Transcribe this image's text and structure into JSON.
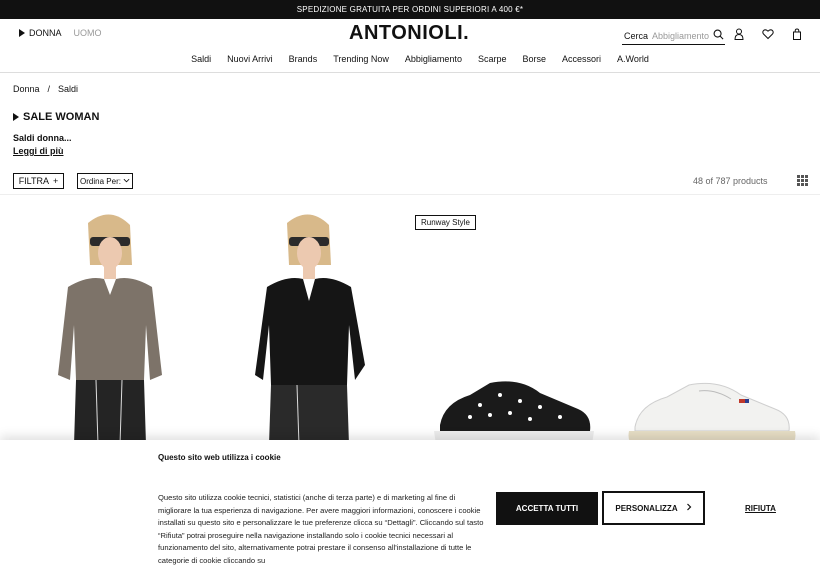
{
  "promo": "SPEDIZIONE GRATUITA PER ORDINI SUPERIORI A 400 €*",
  "header": {
    "gender_active": "DONNA",
    "gender_inactive": "UOMO",
    "logo": "ANTONIOLI.",
    "search_label": "Cerca",
    "search_placeholder": "Abbigliamento"
  },
  "icons": [
    "search-icon",
    "user-icon",
    "heart-icon",
    "bag-icon",
    "grid-view-icon"
  ],
  "nav": [
    "Saldi",
    "Nuovi Arrivi",
    "Brands",
    "Trending Now",
    "Abbigliamento",
    "Scarpe",
    "Borse",
    "Accessori",
    "A.World"
  ],
  "breadcrumb": {
    "home": "Donna",
    "sep": "/",
    "current": "Saldi"
  },
  "page": {
    "title": "SALE WOMAN",
    "description": "Saldi donna...",
    "read_more": "Leggi di più"
  },
  "toolbar": {
    "filter": "FILTRA",
    "sort": "Ordina Per:",
    "count": "48 of 787 products"
  },
  "products": [
    {
      "badge": ""
    },
    {
      "badge": ""
    },
    {
      "badge": "Runway Style"
    },
    {
      "badge": ""
    }
  ],
  "cookie": {
    "title": "Questo sito web utilizza i cookie",
    "body": "Questo sito utilizza cookie tecnici, statistici (anche di terza parte) e di marketing al fine di migliorare la tua esperienza di navigazione. Per avere maggiori informazioni, conoscere i cookie installati su questo sito e personalizzare le tue preferenze clicca su “Dettagli”. Cliccando sul tasto “Rifiuta” potrai proseguire nella navigazione installando solo i cookie tecnici necessari al funzionamento del sito, alternativamente potrai prestare il consenso all'installazione di tutte le categorie di cookie cliccando su",
    "accept": "ACCETTA TUTTI",
    "customize": "PERSONALIZZA",
    "reject": "RIFIUTA"
  }
}
